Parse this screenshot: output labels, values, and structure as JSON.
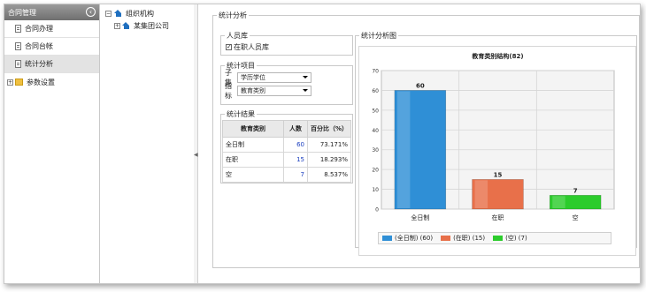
{
  "nav": {
    "title": "合同管理",
    "items": [
      {
        "label": "合同办理",
        "active": false
      },
      {
        "label": "合同台帐",
        "active": false
      },
      {
        "label": "统计分析",
        "active": true
      }
    ],
    "group": {
      "label": "参数设置"
    }
  },
  "tree": {
    "root": "组织机构",
    "child": "某集团公司"
  },
  "main": {
    "section_title": "统计分析",
    "person": {
      "legend": "人员库",
      "checkbox_label": "在职人员库",
      "checked": true
    },
    "stats": {
      "legend": "统计项目",
      "subset_label": "子集",
      "subset_value": "学历学位",
      "indicator_label": "指标",
      "indicator_value": "教育类别"
    },
    "result": {
      "legend": "统计结果",
      "headers": [
        "教育类别",
        "人数",
        "百分比（%）"
      ],
      "rows": [
        {
          "category": "全日制",
          "count": "60",
          "percent": "73.171%"
        },
        {
          "category": "在职",
          "count": "15",
          "percent": "18.293%"
        },
        {
          "category": "空",
          "count": "7",
          "percent": "8.537%"
        }
      ]
    },
    "chart_panel_legend": "统计分析图"
  },
  "chart_data": {
    "type": "bar",
    "title": "教育类别结构(82)",
    "categories": [
      "全日制",
      "在职",
      "空"
    ],
    "values": [
      60,
      15,
      7
    ],
    "data_labels": [
      "60",
      "15",
      "7"
    ],
    "ylim": [
      0,
      70
    ],
    "yticks": [
      "0",
      "10",
      "20",
      "30",
      "40",
      "50",
      "60",
      "70"
    ],
    "colors": [
      "#2f8fd6",
      "#e8704a",
      "#2ccc2c"
    ],
    "grid": true,
    "legend_position": "bottom",
    "legend": [
      "(全日制) (60)",
      "(在职) (15)",
      "(空) (7)"
    ]
  }
}
